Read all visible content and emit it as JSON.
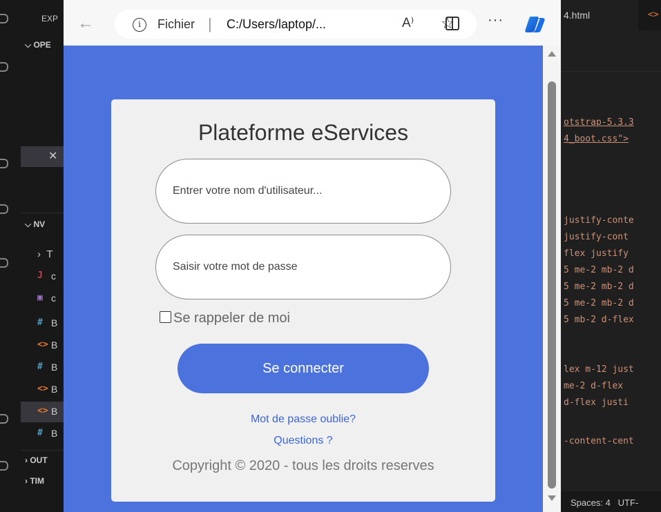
{
  "vscode": {
    "explorer_header": "EXP",
    "open_editors": "OPE",
    "project_section": "NV",
    "outline_section": "OUT",
    "timeline_section": "TIM",
    "file_rows": [
      {
        "icon": "J",
        "letter": "c"
      },
      {
        "icon": "▣",
        "letter": "c"
      },
      {
        "icon": "#",
        "letter": "B"
      },
      {
        "icon": "<>",
        "letter": "B"
      },
      {
        "icon": "#",
        "letter": "B"
      },
      {
        "icon": "<>",
        "letter": "B"
      },
      {
        "icon": "<>",
        "letter": "B"
      },
      {
        "icon": "#",
        "letter": "B"
      }
    ],
    "active_tab": "4.html",
    "second_tab_icon": "<>",
    "code_lines": [
      "otstrap-5.3.3",
      "4_boot.css\">",
      "justify-conte",
      " justify-cont",
      "flex  justify",
      "5 me-2 mb-2 d",
      "5 me-2 mb-2 d",
      "5 me-2 mb-2 d",
      "5 mb-2 d-flex",
      "lex m-12 just",
      " me-2 d-flex ",
      " d-flex justi",
      "-content-cent"
    ],
    "status_spaces": "Spaces: 4",
    "status_encoding": "UTF-"
  },
  "browser": {
    "scheme_label": "Fichier",
    "url": "C:/Users/laptop/...",
    "read_aloud": "A⁾",
    "favorite": "☆",
    "more": "···"
  },
  "page": {
    "title": "Plateforme eServices",
    "username_placeholder": "Entrer votre nom d'utilisateur...",
    "password_placeholder": "Saisir votre mot de passe",
    "remember_label": "Se rappeler de moi",
    "login_button": "Se connecter",
    "forgot_link": "Mot de passe oublie?",
    "questions_link": "Questions ?",
    "copyright": "Copyright © 2020 - tous les droits reserves",
    "colors": {
      "primary": "#4c72dd",
      "card": "#f0f0f0",
      "link": "#3b66d4"
    }
  }
}
